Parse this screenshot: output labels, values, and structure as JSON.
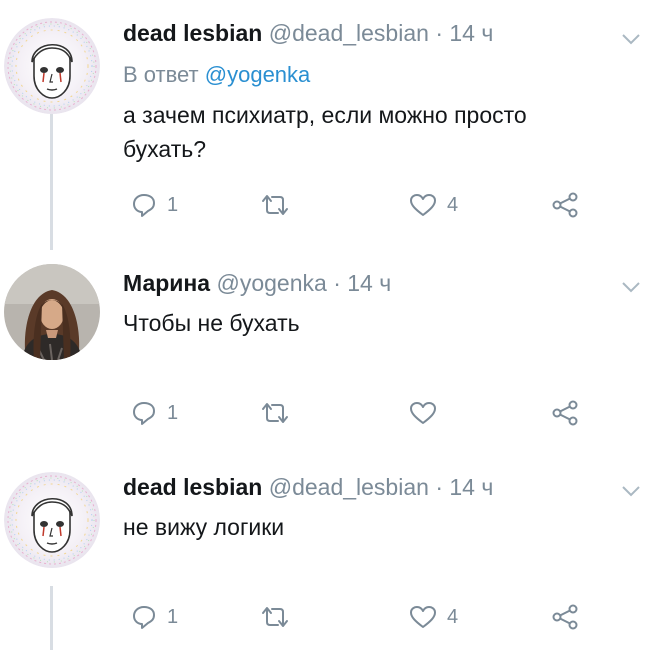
{
  "tweets": [
    {
      "name": "dead lesbian",
      "handle": "@dead_lesbian",
      "dot": "·",
      "time": "14 ч",
      "reply_prefix": "В ответ",
      "reply_handle": "@yogenka",
      "text_line1": "а зачем психиатр, если можно просто",
      "text_line2": "бухать?",
      "replies": "1",
      "retweets": "",
      "likes": "4"
    },
    {
      "name": "Марина",
      "handle": "@yogenka",
      "dot": "·",
      "time": "14 ч",
      "text_line1": "Чтобы не бухать",
      "replies": "1",
      "retweets": "",
      "likes": ""
    },
    {
      "name": "dead lesbian",
      "handle": "@dead_lesbian",
      "dot": "·",
      "time": "14 ч",
      "text_line1": "не вижу логики",
      "replies": "1",
      "retweets": "",
      "likes": "4"
    }
  ],
  "icons": {
    "reply": "reply-icon",
    "retweet": "retweet-icon",
    "like": "heart-icon",
    "share": "share-icon",
    "caret": "chevron-down-icon"
  },
  "colors": {
    "name": "#14171a",
    "muted": "#7b8a97",
    "link": "#2a8fd1",
    "thread_line": "#d8dde3"
  }
}
